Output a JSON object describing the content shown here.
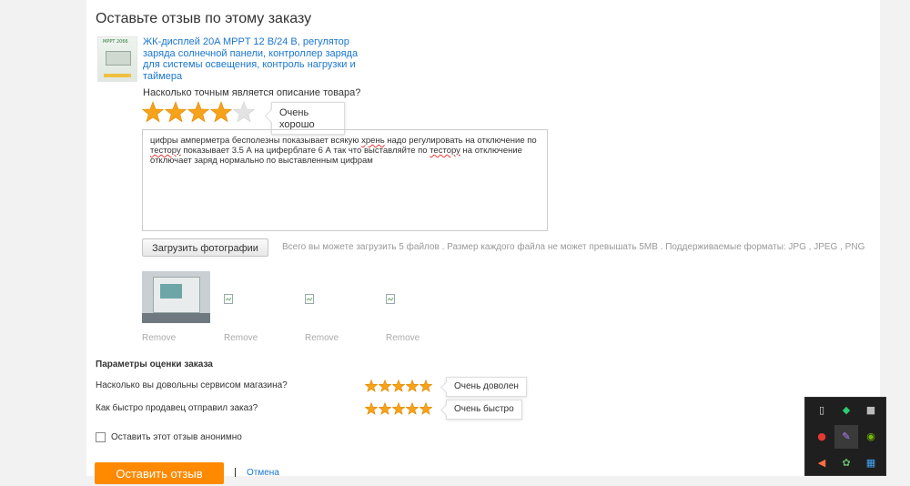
{
  "page": {
    "title": "Оставьте отзыв по этому заказу"
  },
  "product": {
    "name": "ЖК-дисплей 20A MPPT 12 В/24 В, регулятор заряда солнечной панели, контроллер заряда для системы освещения, контроль нагрузки и таймера",
    "image_label": "MPPT 2066"
  },
  "rating": {
    "question": "Насколько точным является описание товара?",
    "stars": 4,
    "max_stars": 5,
    "tooltip": "Очень хорошо"
  },
  "review": {
    "parts": [
      "цифры амперметра бесполезны показывает всякую ",
      "хрень",
      " надо регулировать на отключение  по ",
      "тестору",
      " показывает 3.5  А на  циферблате 6 А  так что выставляйте по ",
      "тестору",
      " на отключение отключает заряд нормально по выставленным цифрам"
    ]
  },
  "upload": {
    "button_label": "Загрузить фотографии",
    "hint": "Всего вы можете загрузить 5 файлов . Размер каждого файла не может превышать 5MB . Поддерживаемые форматы: JPG , JPEG , PNG"
  },
  "photos": {
    "remove_labels": [
      "Remove",
      "Remove",
      "Remove",
      "Remove"
    ]
  },
  "seller": {
    "section_title": "Параметры оценки заказа",
    "questions": [
      {
        "text": "Насколько вы довольны сервисом магазина?",
        "stars": 5,
        "tooltip": "Очень доволен"
      },
      {
        "text": "Как быстро продавец отправил заказ?",
        "stars": 5,
        "tooltip": "Очень быстро"
      }
    ]
  },
  "anonymous": {
    "label": "Оставить этот отзыв анонимно",
    "checked": false
  },
  "actions": {
    "submit_label": "Оставить отзыв",
    "cancel_label": "Отмена"
  },
  "colors": {
    "star_filled": "#f7a21b",
    "star_empty": "#e3e3e3",
    "link": "#1976d2",
    "submit_bg": "#ff8a00"
  },
  "tray": {
    "icons": [
      "usb-drive-icon",
      "shield-icon",
      "cube-icon",
      "opera-icon",
      "feather-icon",
      "nvidia-icon",
      "arrow-icon",
      "leaf-icon",
      "grid-icon"
    ]
  }
}
